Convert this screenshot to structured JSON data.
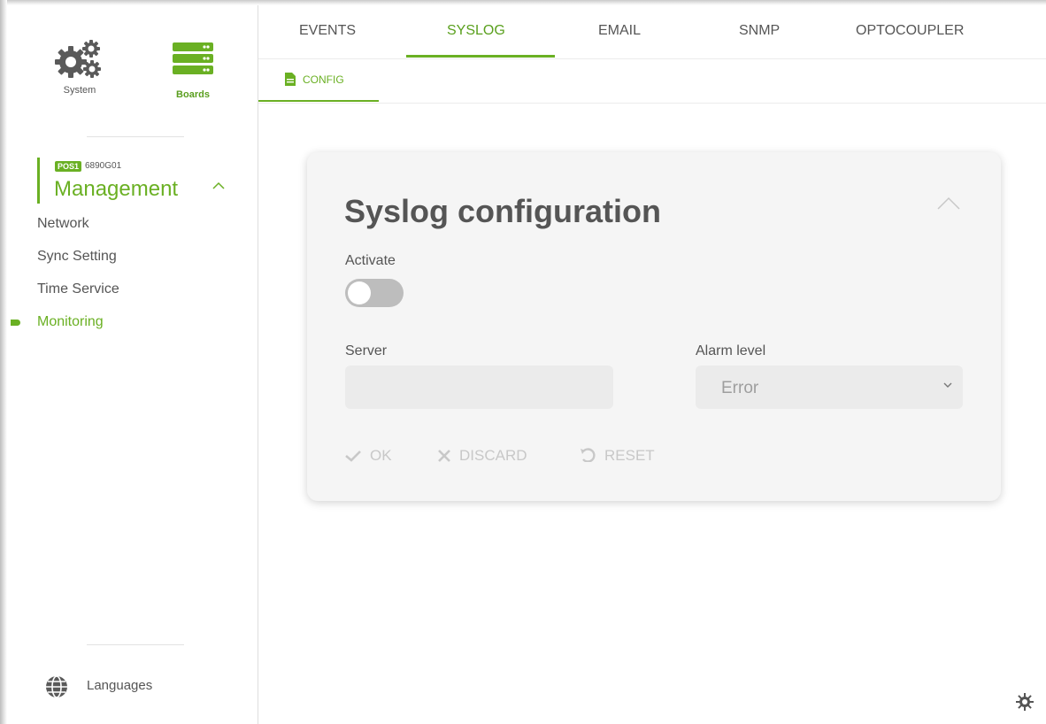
{
  "sidebar": {
    "system_label": "System",
    "boards_label": "Boards",
    "board": {
      "badge": "POS1",
      "code": "6890G01",
      "title": "Management"
    },
    "items": [
      {
        "label": "Network"
      },
      {
        "label": "Sync Setting"
      },
      {
        "label": "Time Service"
      },
      {
        "label": "Monitoring",
        "active": true
      }
    ],
    "languages_label": "Languages"
  },
  "tabs": [
    {
      "label": "EVENTS"
    },
    {
      "label": "SYSLOG",
      "active": true
    },
    {
      "label": "EMAIL"
    },
    {
      "label": "SNMP"
    },
    {
      "label": "OPTOCOUPLER"
    }
  ],
  "subtabs": [
    {
      "label": "CONFIG",
      "icon": "document-icon",
      "active": true
    }
  ],
  "card": {
    "title": "Syslog configuration",
    "activate_label": "Activate",
    "activate_state": false,
    "server_label": "Server",
    "server_value": "",
    "alarm_label": "Alarm level",
    "alarm_value": "Error",
    "actions": {
      "ok": "OK",
      "discard": "DISCARD",
      "reset": "RESET"
    }
  },
  "colors": {
    "accent": "#6ab023",
    "text": "#555555",
    "disabled": "#c8c8c8"
  }
}
